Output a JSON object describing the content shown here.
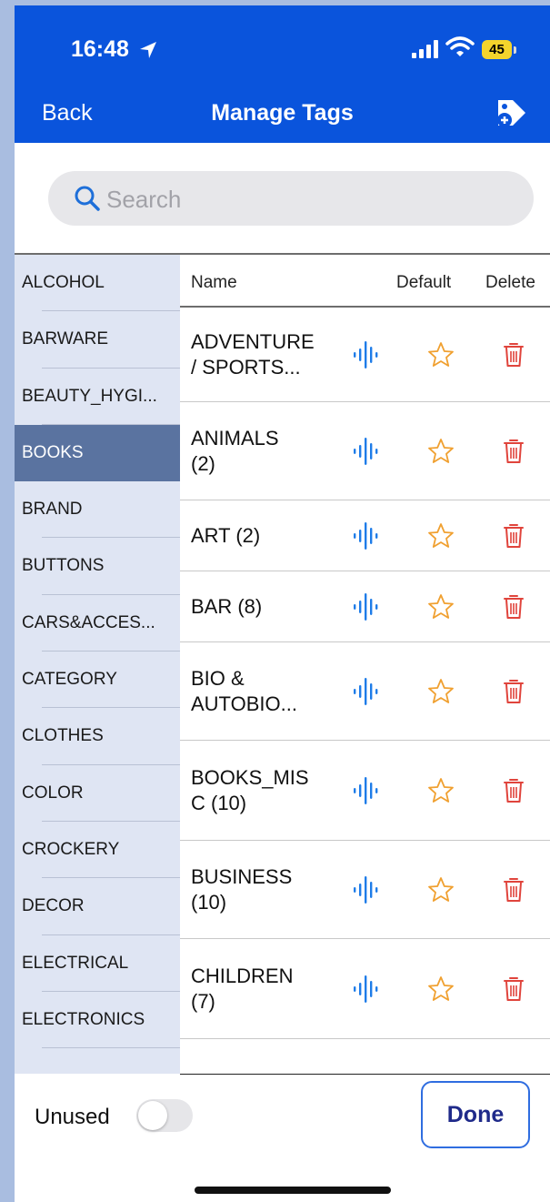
{
  "status_bar": {
    "time": "16:48",
    "battery": "45"
  },
  "nav": {
    "back_label": "Back",
    "title": "Manage Tags"
  },
  "search": {
    "placeholder": "Search",
    "value": ""
  },
  "categories": [
    {
      "label": "ALCOHOL"
    },
    {
      "label": "BARWARE"
    },
    {
      "label": "BEAUTY_HYGI..."
    },
    {
      "label": "BOOKS",
      "selected": true
    },
    {
      "label": "BRAND"
    },
    {
      "label": "BUTTONS"
    },
    {
      "label": "CARS&ACCES..."
    },
    {
      "label": "CATEGORY"
    },
    {
      "label": "CLOTHES"
    },
    {
      "label": "COLOR"
    },
    {
      "label": "CROCKERY"
    },
    {
      "label": "DECOR"
    },
    {
      "label": "ELECTRICAL"
    },
    {
      "label": "ELECTRONICS"
    }
  ],
  "table": {
    "headers": {
      "name": "Name",
      "default": "Default",
      "delete": "Delete"
    },
    "rows": [
      {
        "line1": "ADVENTURE",
        "line2": "/ SPORTS..."
      },
      {
        "line1": "ANIMALS",
        "line2": "(2)"
      },
      {
        "line1": "ART  (2)",
        "line2": ""
      },
      {
        "line1": "BAR  (8)",
        "line2": ""
      },
      {
        "line1": "BIO &",
        "line2": "AUTOBIO..."
      },
      {
        "line1": "BOOKS_MIS",
        "line2": "C  (10)"
      },
      {
        "line1": "BUSINESS",
        "line2": "(10)"
      },
      {
        "line1": "CHILDREN",
        "line2": "(7)"
      }
    ]
  },
  "footer": {
    "unused_label": "Unused",
    "unused_on": false,
    "done_label": "Done"
  },
  "colors": {
    "nav_bar": "#0a54dc",
    "sidebar_bg": "#dfe5f3",
    "sidebar_selected": "#5a73a0",
    "voice_icon": "#1e7ce8",
    "star_icon": "#f0a030",
    "trash_icon": "#e0443c",
    "done_text": "#1f2a8a"
  },
  "icons": {
    "add_tag": "tag-plus-icon",
    "search": "magnifier-icon",
    "row_voice": "audio-waveform-icon",
    "row_default": "star-outline-icon",
    "row_delete": "trash-icon"
  }
}
